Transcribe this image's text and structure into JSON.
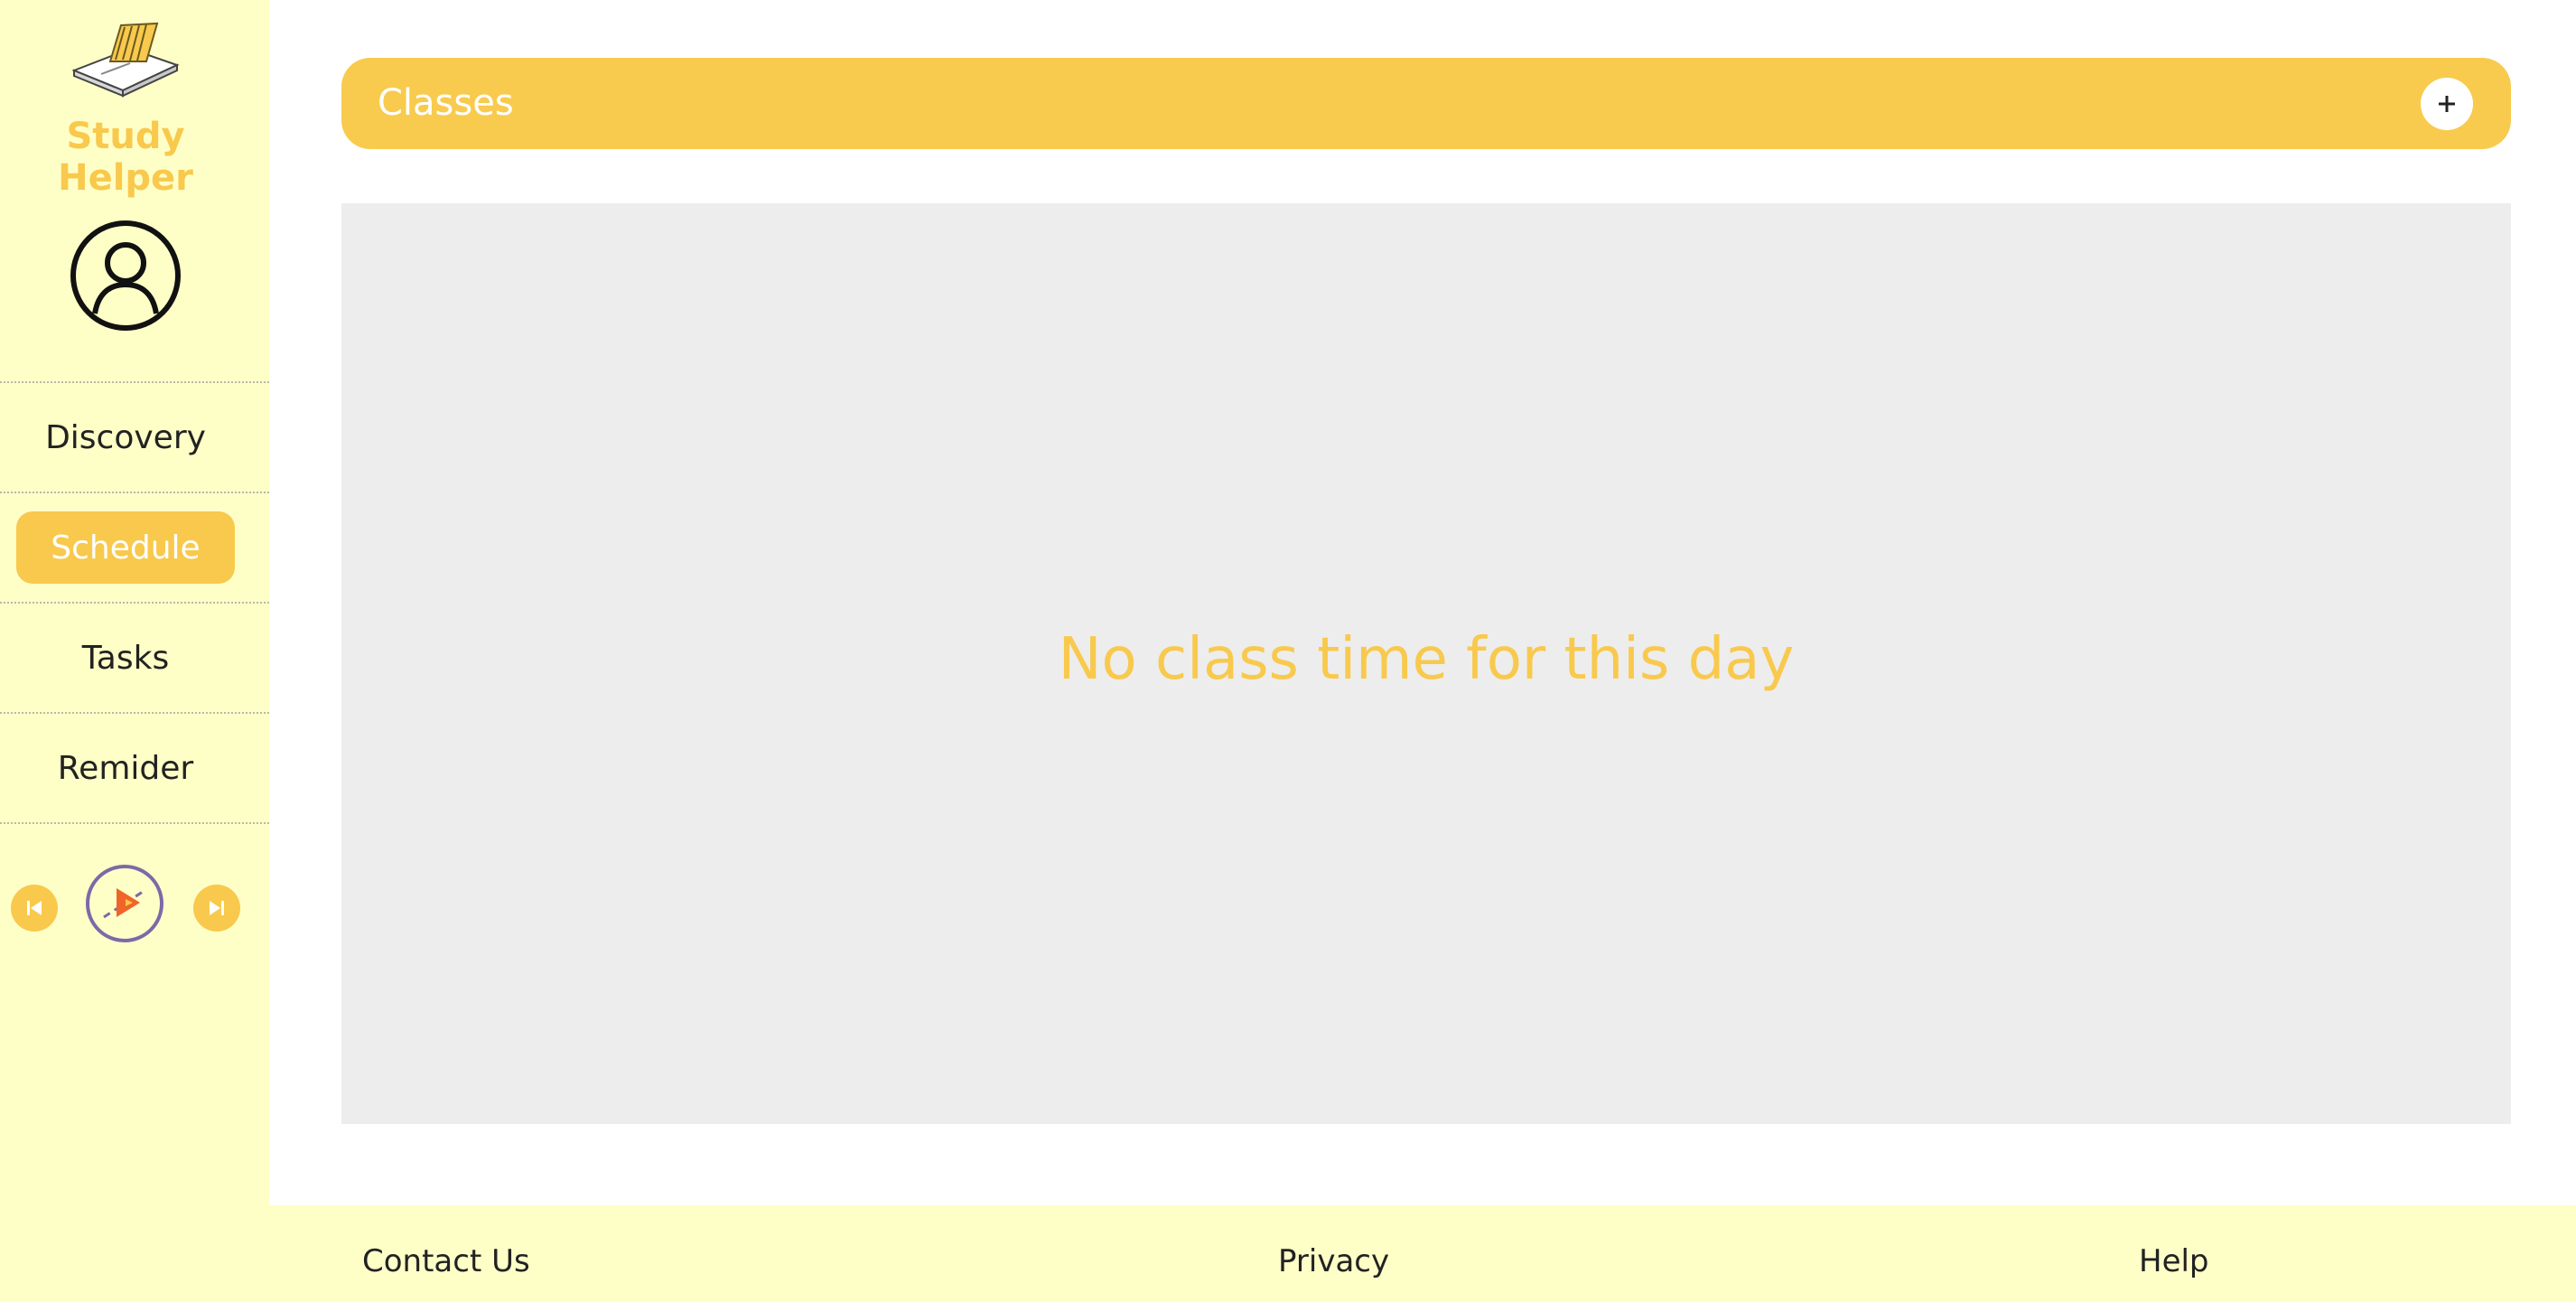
{
  "app": {
    "name": "Study Helper",
    "logo_icon": "open-book-icon",
    "avatar_icon": "user-circle-icon"
  },
  "sidebar": {
    "items": [
      {
        "label": "Discovery",
        "active": false
      },
      {
        "label": "Schedule",
        "active": true
      },
      {
        "label": "Tasks",
        "active": false
      },
      {
        "label": "Remider",
        "active": false
      }
    ]
  },
  "player": {
    "prev_icon": "skip-previous-icon",
    "play_icon": "play-disc-icon",
    "next_icon": "skip-next-icon"
  },
  "header": {
    "title": "Classes",
    "add_icon": "plus-icon",
    "add_label": "+"
  },
  "main": {
    "empty_message": "No class time for this day"
  },
  "footer": {
    "links": [
      "Contact Us",
      "Privacy",
      "Help"
    ]
  },
  "colors": {
    "accent": "#f8c94c",
    "sidebar_bg": "#feffc7",
    "panel_bg": "#ededed",
    "player_ring": "#7a6aa8",
    "play_triangle": "#f0642a"
  }
}
